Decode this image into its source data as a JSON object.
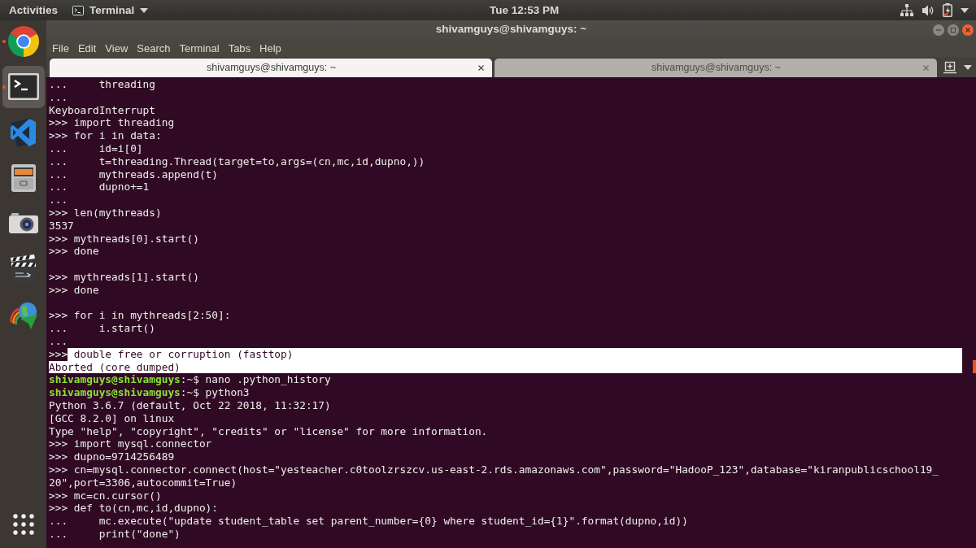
{
  "top_bar": {
    "activities": "Activities",
    "app_menu": "Terminal",
    "clock": "Tue 12:53 PM"
  },
  "dock": {
    "items": [
      {
        "kind": "browser",
        "running": true,
        "selected": false
      },
      {
        "kind": "terminal",
        "running": true,
        "selected": true
      },
      {
        "kind": "code_editor",
        "running": false,
        "selected": false
      },
      {
        "kind": "file_cabinet",
        "running": false,
        "selected": false
      },
      {
        "kind": "camera",
        "running": false,
        "selected": false
      },
      {
        "kind": "clapperboard",
        "running": false,
        "selected": false
      },
      {
        "kind": "globe_download",
        "running": false,
        "selected": false
      }
    ]
  },
  "window": {
    "title": "shivamguys@shivamguys: ~",
    "menu": [
      "File",
      "Edit",
      "View",
      "Search",
      "Terminal",
      "Tabs",
      "Help"
    ],
    "tabs": [
      {
        "label": "shivamguys@shivamguys: ~",
        "selected": true
      },
      {
        "label": "shivamguys@shivamguys: ~",
        "selected": false
      }
    ],
    "terminal": {
      "lines": [
        {
          "text": "...     threading"
        },
        {
          "text": "..."
        },
        {
          "text": "KeyboardInterrupt"
        },
        {
          "text": ">>> import threading"
        },
        {
          "text": ">>> for i in data:"
        },
        {
          "text": "...     id=i[0]"
        },
        {
          "text": "...     t=threading.Thread(target=to,args=(cn,mc,id,dupno,))"
        },
        {
          "text": "...     mythreads.append(t)"
        },
        {
          "text": "...     dupno+=1"
        },
        {
          "text": "..."
        },
        {
          "text": ">>> len(mythreads)"
        },
        {
          "text": "3537"
        },
        {
          "text": ">>> mythreads[0].start()"
        },
        {
          "text": ">>> done"
        },
        {
          "text": ">>> mythreads[1].start()",
          "blank_before": true
        },
        {
          "text": ">>> done"
        },
        {
          "text": ">>> for i in mythreads[2:50]:",
          "blank_before": true
        },
        {
          "text": "...     i.start()"
        },
        {
          "text": "..."
        },
        {
          "segments": [
            {
              "kind": "plain",
              "text": ">>>"
            },
            {
              "kind": "selection",
              "text": " double free or corruption (fasttop)"
            }
          ]
        },
        {
          "segments": [
            {
              "kind": "selection",
              "text": "Aborted (core dumped)"
            }
          ]
        },
        {
          "segments": [
            {
              "kind": "user",
              "text": "shivamguys@shivamguys"
            },
            {
              "kind": "plain",
              "text": ":~$ nano .python_history"
            }
          ]
        },
        {
          "segments": [
            {
              "kind": "user",
              "text": "shivamguys@shivamguys"
            },
            {
              "kind": "plain",
              "text": ":~$ python3"
            }
          ]
        },
        {
          "text": "Python 3.6.7 (default, Oct 22 2018, 11:32:17)"
        },
        {
          "text": "[GCC 8.2.0] on linux"
        },
        {
          "text": "Type \"help\", \"copyright\", \"credits\" or \"license\" for more information."
        },
        {
          "text": ">>> import mysql.connector"
        },
        {
          "text": ">>> dupno=9714256489"
        },
        {
          "text": ">>> cn=mysql.connector.connect(host=\"yesteacher.c0toolzrszcv.us-east-2.rds.amazonaws.com\",password=\"HadooP_123\",database=\"kiranpublicschool19_"
        },
        {
          "text": "20\",port=3306,autocommit=True)"
        },
        {
          "text": ">>> mc=cn.cursor()"
        },
        {
          "text": ">>> def to(cn,mc,id,dupno):"
        },
        {
          "text": "...     mc.execute(\"update student_table set parent_number={0} where student_id={1}\".format(dupno,id))"
        },
        {
          "text": "...     print(\"done\")"
        }
      ]
    }
  }
}
